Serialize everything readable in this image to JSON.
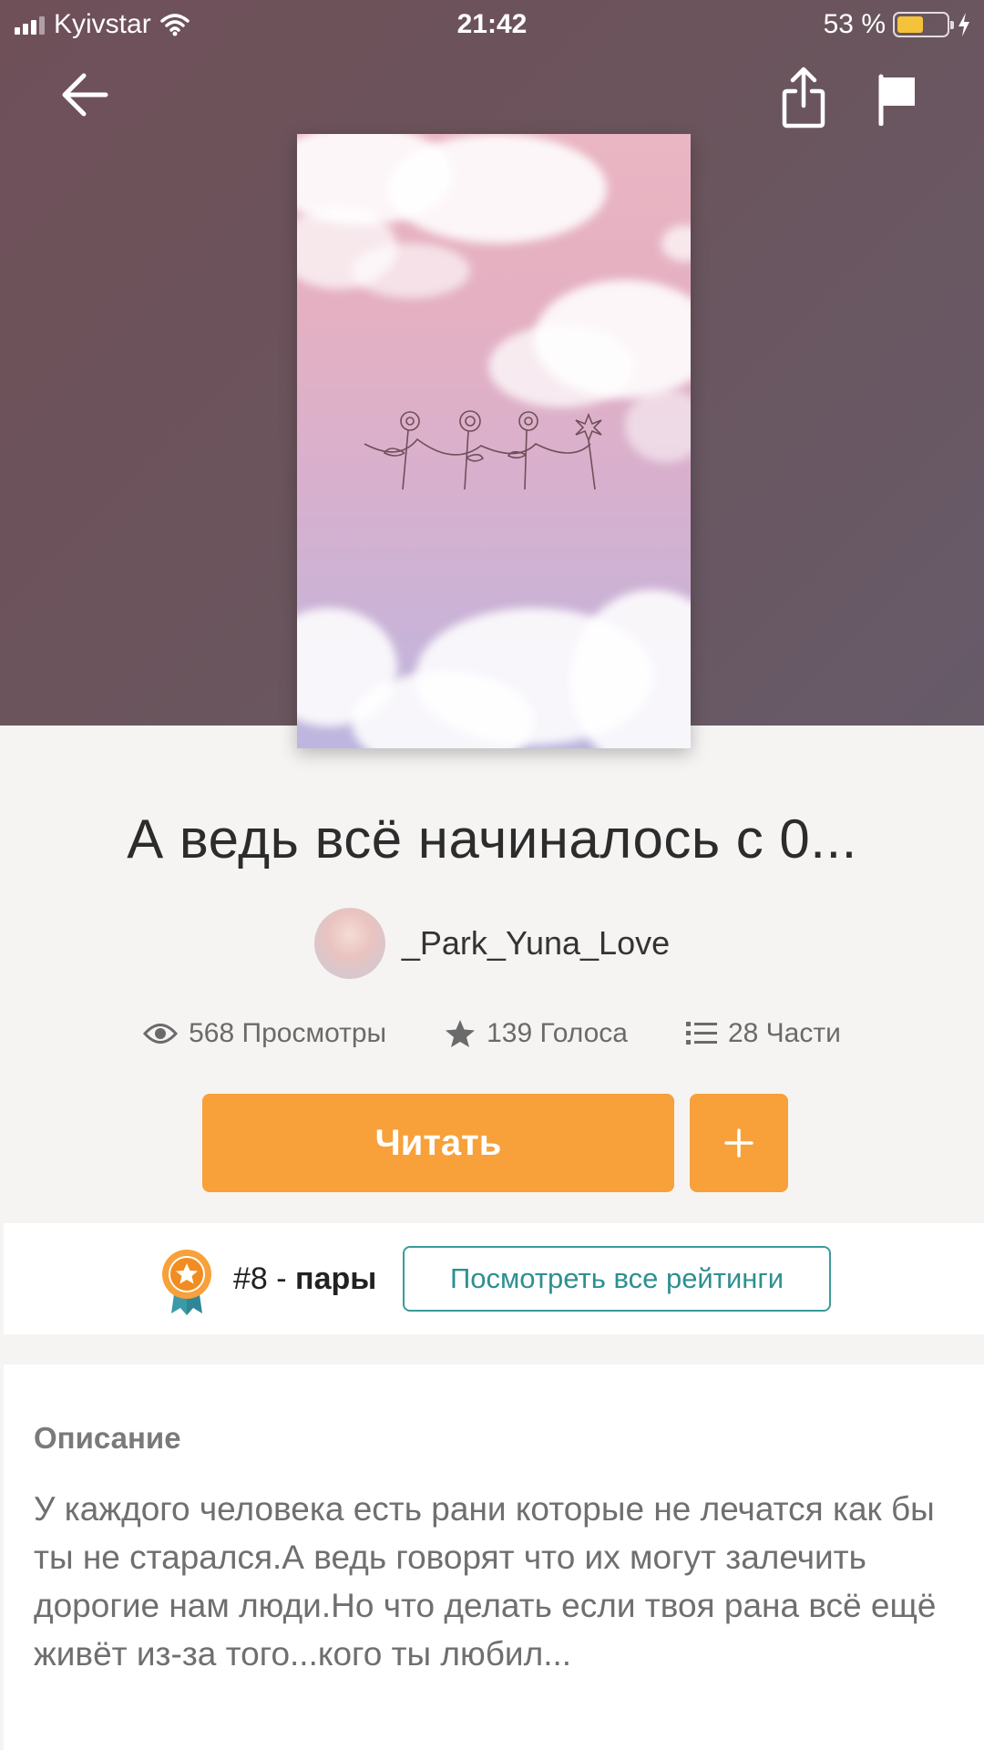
{
  "status_bar": {
    "carrier": "Kyivstar",
    "time": "21:42",
    "battery_percent": "53 %",
    "battery_level": 0.53
  },
  "nav": {
    "back_icon": "arrow-left-icon",
    "share_icon": "share-icon",
    "report_icon": "flag-icon"
  },
  "story": {
    "title": "А ведь всё начиналось с  0...",
    "author": "_Park_Yuna_Love"
  },
  "stats": {
    "views": "568 Просмотры",
    "votes": "139 Голоса",
    "parts": "28 Части"
  },
  "actions": {
    "read_label": "Читать",
    "add_label": "+"
  },
  "ranking": {
    "rank": "#8",
    "separator": " - ",
    "category": "пары",
    "view_all_label": "Посмотреть все рейтинги"
  },
  "description": {
    "label": "Описание",
    "text": "У каждого человека есть рани которые не лечатся как бы ты не старался.А ведь говорят что их могут залечить дорогие нам люди.Но что делать если твоя рана всё ещё живёт из-за того...кого ты любил..."
  },
  "colors": {
    "accent": "#f8a03a",
    "teal": "#3a9a9b"
  }
}
